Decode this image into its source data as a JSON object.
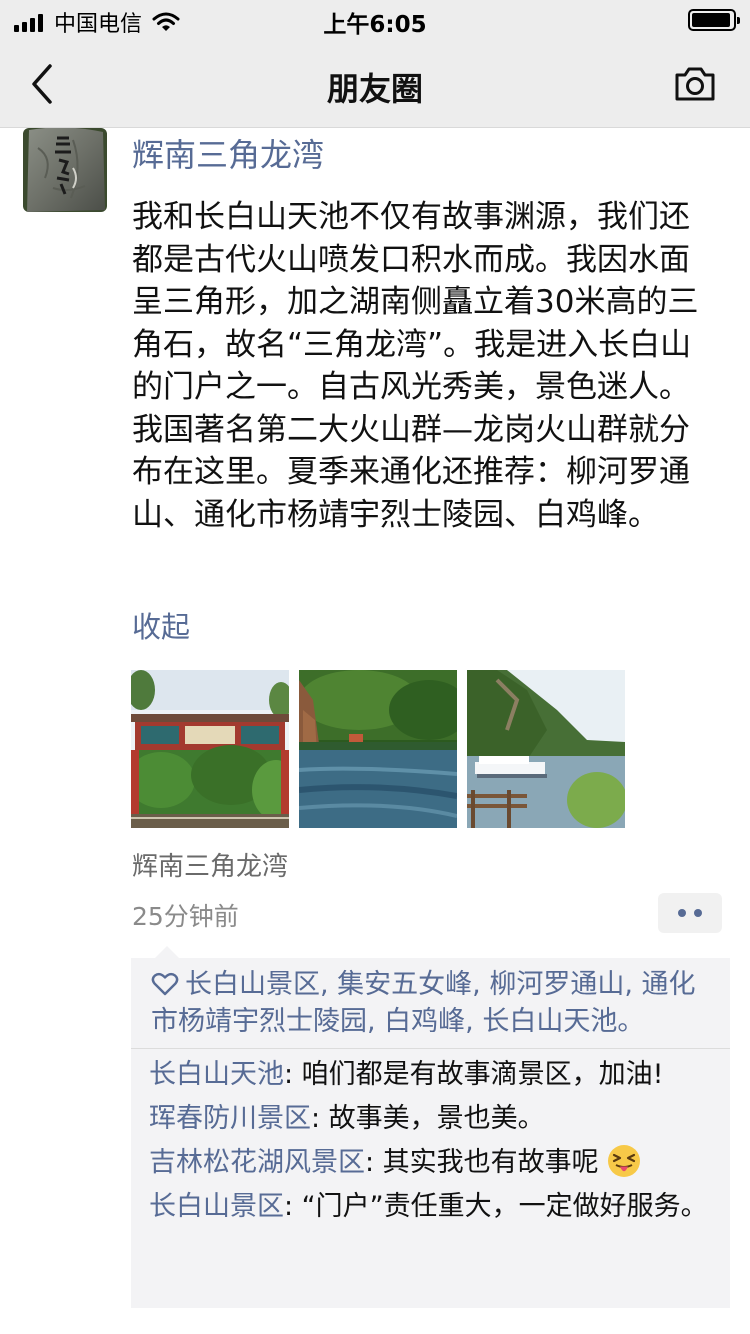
{
  "status_bar": {
    "carrier": "中国电信",
    "time": "上午6:05"
  },
  "nav": {
    "title": "朋友圈",
    "back_icon": "chevron-left-icon",
    "camera_icon": "camera-icon"
  },
  "post": {
    "author": "辉南三角龙湾",
    "text": "我和长白山天池不仅有故事渊源，我们还都是古代火山喷发口积水而成。我因水面呈三角形，加之湖南侧矗立着30米高的三角石，故名“三角龙湾”。我是进入长白山的门户之一。自古风光秀美，景色迷人。我国著名第二大火山群—龙岗火山群就分布在这里。夏季来通化还推荐：柳河罗通山、通化市杨靖宇烈士陵园、白鸡峰。",
    "collapse_label": "收起",
    "location": "辉南三角龙湾",
    "time": "25分钟前",
    "photos": [
      "gate-photo",
      "lake-pavilion-photo",
      "lake-boat-photo"
    ]
  },
  "likes": {
    "names": [
      "长白山景区",
      "集安五女峰",
      "柳河罗通山",
      "通化市杨靖宇烈士陵园",
      "白鸡峰",
      "长白山天池"
    ],
    "end": "。"
  },
  "comments": [
    {
      "name": "长白山天池",
      "text": ": 咱们都是有故事滴景区，加油!"
    },
    {
      "name": "珲春防川景区",
      "text": ": 故事美，景也美。"
    },
    {
      "name": "吉林松花湖风景区",
      "text": ": 其实我也有故事呢",
      "emoji": "tongue-face-emoji"
    },
    {
      "name": "长白山景区",
      "text": ": “门户”责任重大，一定做好服务。"
    }
  ],
  "colors": {
    "link_blue": "#576b95",
    "nav_bg": "#ededed",
    "comment_bg": "#f3f3f5"
  }
}
